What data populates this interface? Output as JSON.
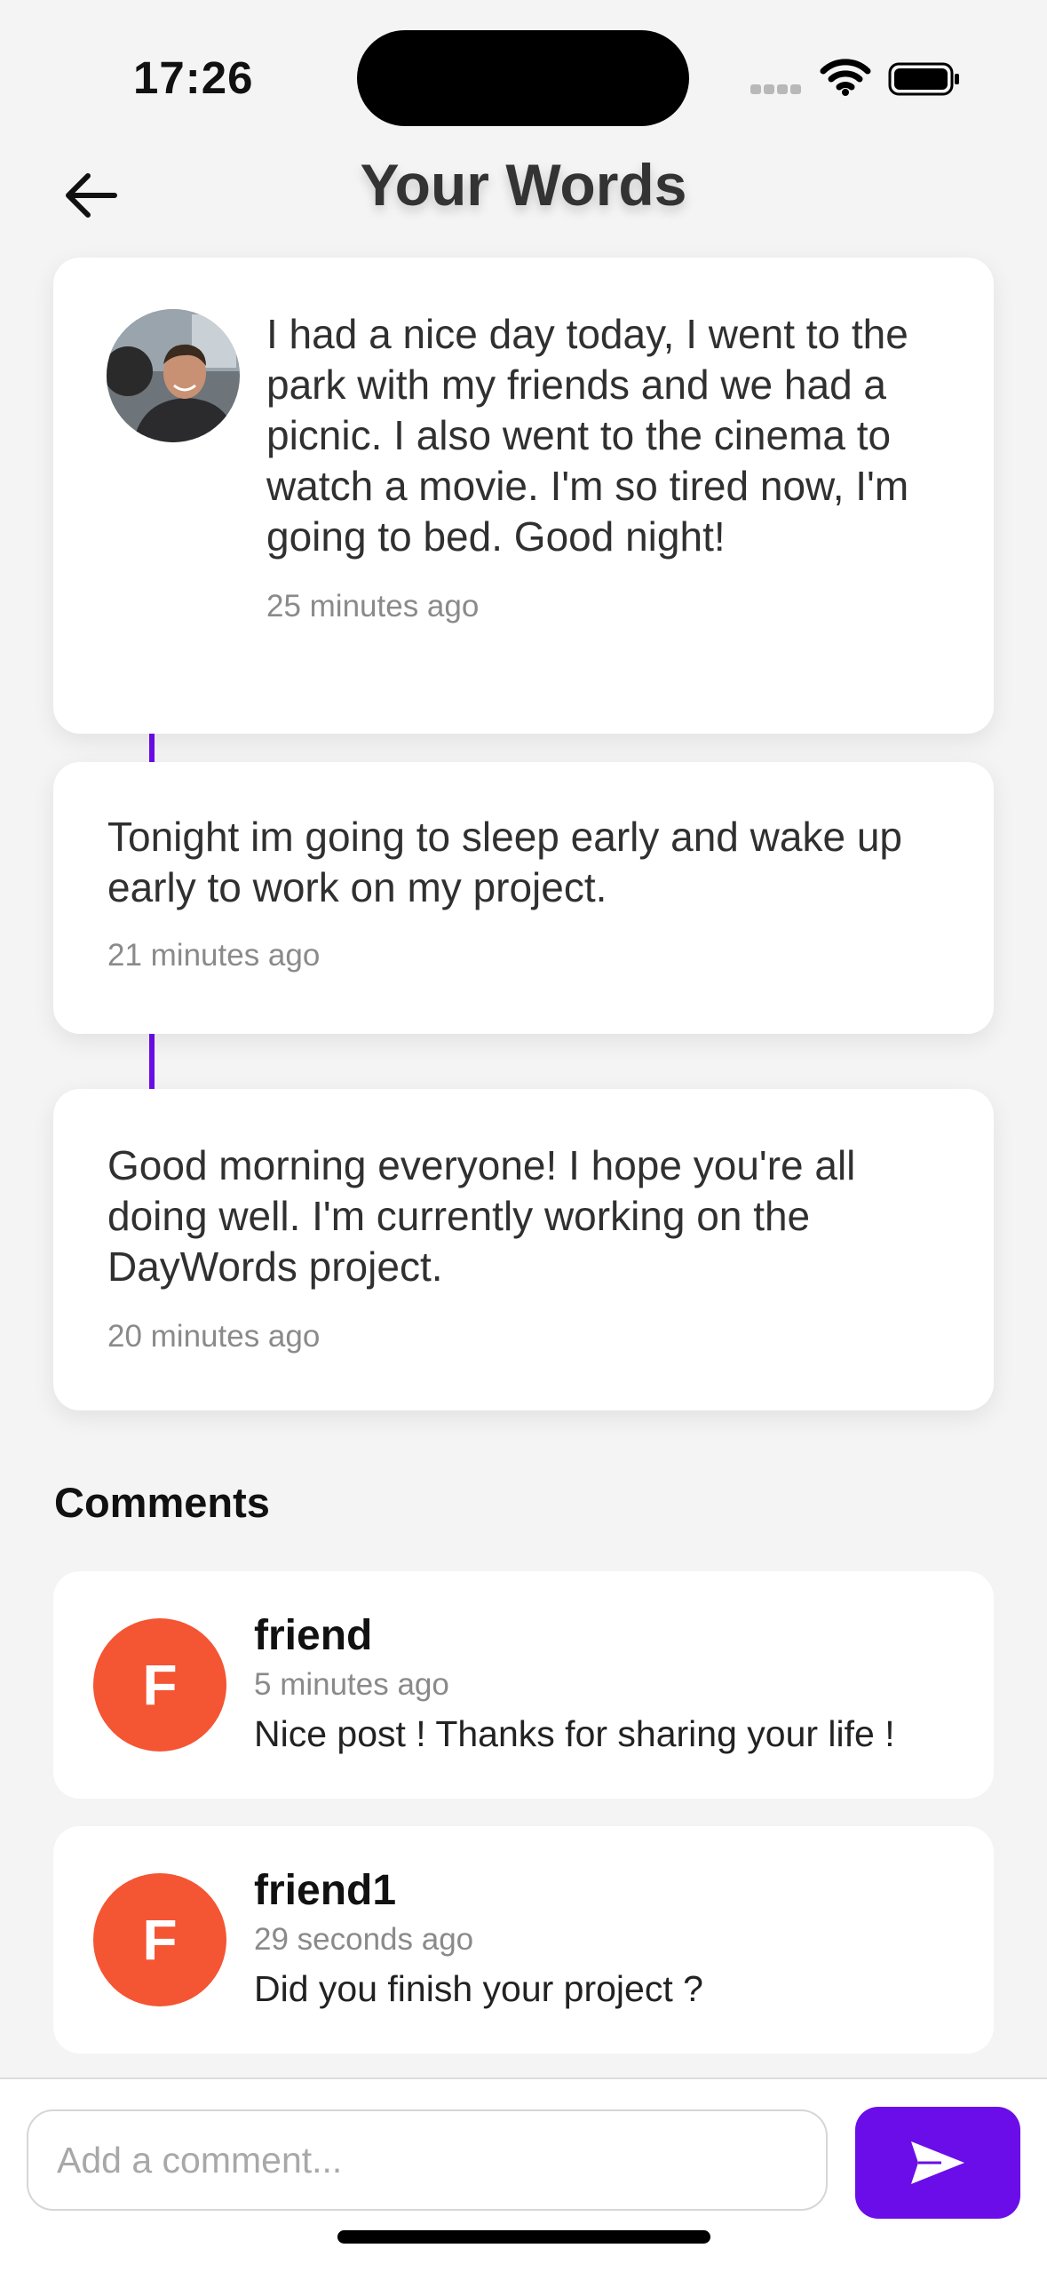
{
  "status_bar": {
    "time": "17:26"
  },
  "header": {
    "title": "Your Words",
    "back_icon": "arrow-left-icon"
  },
  "colors": {
    "accent": "#6b0de8",
    "avatar_bg": "#f45533",
    "background": "#f4f4f4"
  },
  "posts": [
    {
      "text": "I had a nice day today, I went to the park with my friends and we had a picnic. I also went to the cinema to watch a movie. I'm so tired now, I'm going to bed. Good night!",
      "time": "25 minutes ago"
    },
    {
      "text": "Tonight im going to sleep early and wake up early to work on my project.",
      "time": "21 minutes ago"
    },
    {
      "text": "Good morning everyone! I hope you're all doing well. I'm currently working on the DayWords project.",
      "time": "20 minutes ago"
    }
  ],
  "comments_section": {
    "title": "Comments",
    "items": [
      {
        "initial": "F",
        "author": "friend",
        "time": "5 minutes ago",
        "text": "Nice post ! Thanks for sharing your life !"
      },
      {
        "initial": "F",
        "author": "friend1",
        "time": "29 seconds ago",
        "text": "Did you finish your project ?"
      }
    ]
  },
  "composer": {
    "placeholder": "Add a comment...",
    "send_icon": "send-icon"
  }
}
